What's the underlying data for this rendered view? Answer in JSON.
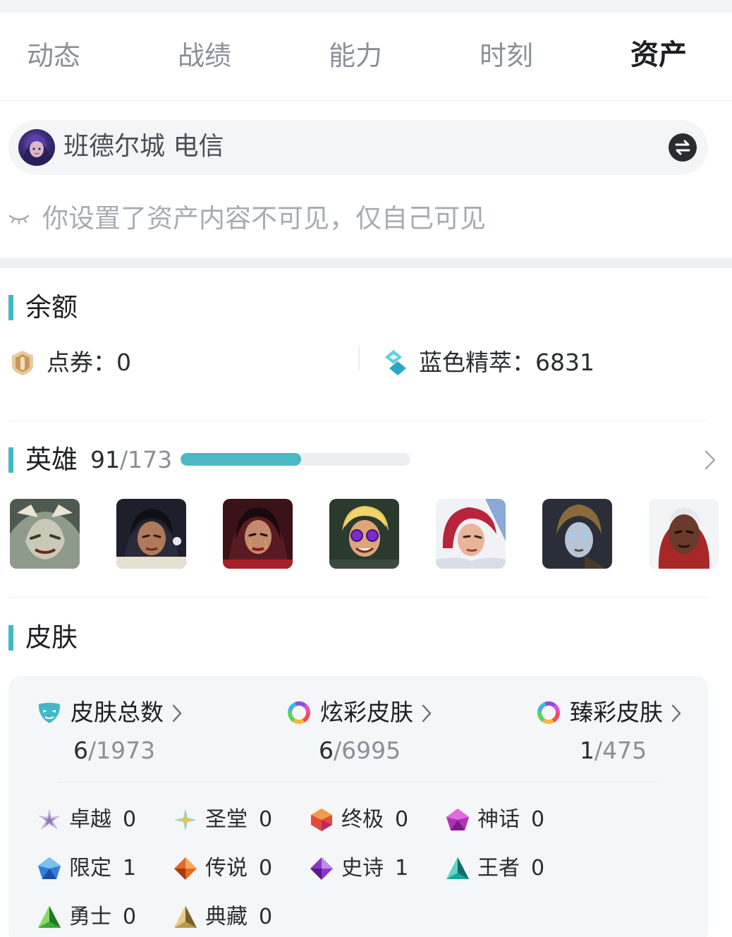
{
  "tabs": [
    {
      "label": "动态"
    },
    {
      "label": "战绩"
    },
    {
      "label": "能力"
    },
    {
      "label": "时刻"
    },
    {
      "label": "资产",
      "active": true
    }
  ],
  "server": {
    "name": "班德尔城 电信"
  },
  "privacy_note": "你设置了资产内容不可见，仅自己可见",
  "balance": {
    "title": "余额",
    "items": [
      {
        "label": "点券：0",
        "icon": "coupon-icon"
      },
      {
        "label": "蓝色精萃：6831",
        "icon": "blue-essence-icon"
      }
    ]
  },
  "heroes": {
    "title": "英雄",
    "owned": "91",
    "separator": "/",
    "total": "173",
    "progress": 0.526,
    "icons": [
      "hero-rengar",
      "hero-samira",
      "hero-morgana",
      "hero-ezreal",
      "hero-fiora",
      "hero-ezreal-skin",
      "hero-ekko"
    ]
  },
  "skins": {
    "title": "皮肤",
    "stats": [
      {
        "label": "皮肤总数",
        "owned": "6",
        "separator": "/",
        "total": "1973",
        "icon": "mask-icon"
      },
      {
        "label": "炫彩皮肤",
        "owned": "6",
        "separator": "/",
        "total": "6995",
        "icon": "chroma-icon"
      },
      {
        "label": "臻彩皮肤",
        "owned": "1",
        "separator": "/",
        "total": "475",
        "icon": "prestige-chroma-icon"
      }
    ],
    "tiers": [
      {
        "label": "卓越",
        "count": "0",
        "icon": "transcendent-icon",
        "color": "#b9a7d6"
      },
      {
        "label": "圣堂",
        "count": "0",
        "icon": "exalted-icon",
        "color": "#7fd6c8"
      },
      {
        "label": "终极",
        "count": "0",
        "icon": "ultimate-icon",
        "color": "#e0503a"
      },
      {
        "label": "神话",
        "count": "0",
        "icon": "mythic-icon",
        "color": "#b42fb8"
      },
      {
        "label": "限定",
        "count": "1",
        "icon": "limited-icon",
        "color": "#2f7fd8"
      },
      {
        "label": "传说",
        "count": "0",
        "icon": "legendary-icon",
        "color": "#e06b2a"
      },
      {
        "label": "史诗",
        "count": "1",
        "icon": "epic-icon",
        "color": "#8a35c9"
      },
      {
        "label": "王者",
        "count": "0",
        "icon": "legacy-icon",
        "color": "#1aa39a"
      },
      {
        "label": "勇士",
        "count": "0",
        "icon": "warrior-icon",
        "color": "#3aa83a"
      },
      {
        "label": "典藏",
        "count": "0",
        "icon": "collection-icon",
        "color": "#b79a4a"
      }
    ]
  },
  "colors": {
    "accent": "#42b7c6",
    "progress": "#4bb8c4",
    "text_primary": "#1e1f24",
    "text_muted": "#8a8f99"
  }
}
